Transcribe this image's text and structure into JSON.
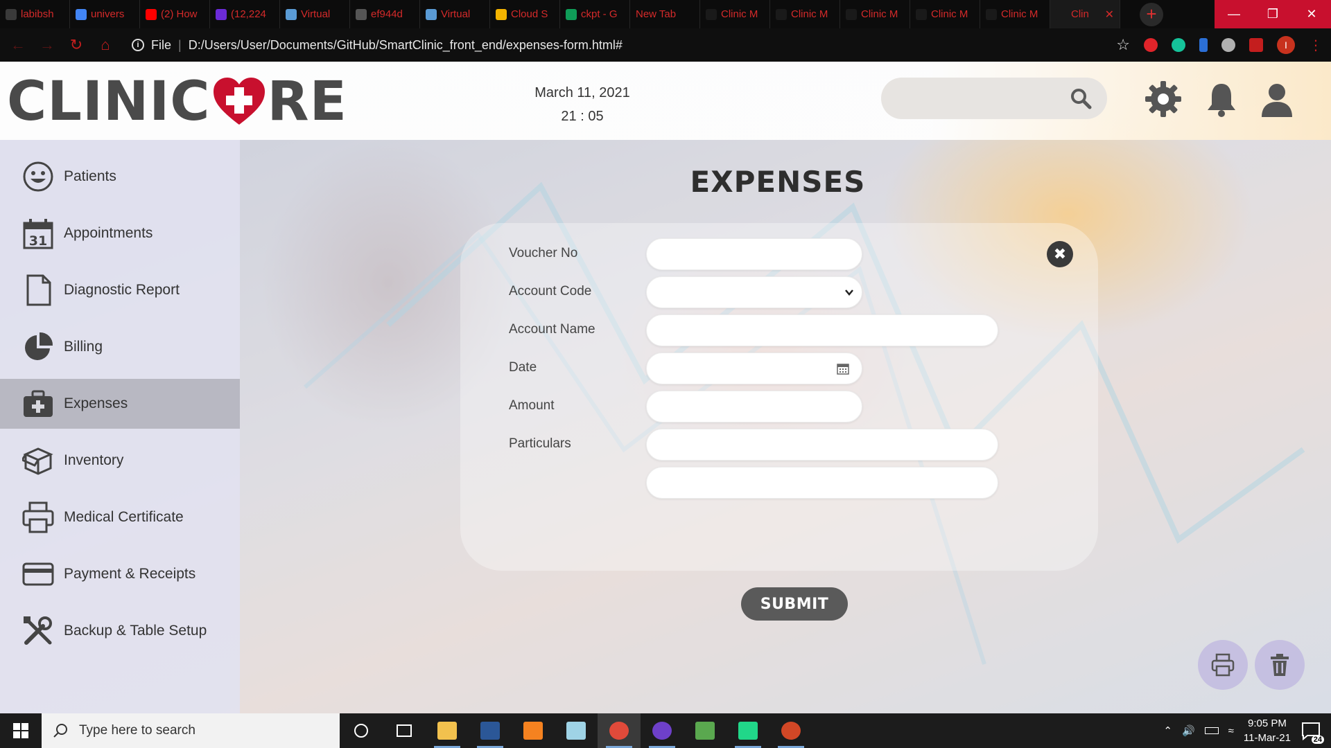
{
  "browser": {
    "tabs": [
      {
        "title": "labibsh",
        "fav": "#3a3a3a"
      },
      {
        "title": "univers",
        "fav": "#4285f4"
      },
      {
        "title": "(2) How",
        "fav": "#ff0000"
      },
      {
        "title": "(12,224",
        "fav": "#6b2bd8"
      },
      {
        "title": "Virtual",
        "fav": "#5a9bd5"
      },
      {
        "title": "ef944d",
        "fav": "#555555"
      },
      {
        "title": "Virtual",
        "fav": "#5a9bd5"
      },
      {
        "title": "Cloud S",
        "fav": "#f4b400"
      },
      {
        "title": "ckpt - G",
        "fav": "#0f9d58"
      },
      {
        "title": "New Tab",
        "fav": ""
      },
      {
        "title": "Clinic M",
        "fav": "#1a1a1a"
      },
      {
        "title": "Clinic M",
        "fav": "#1a1a1a"
      },
      {
        "title": "Clinic M",
        "fav": "#1a1a1a"
      },
      {
        "title": "Clinic M",
        "fav": "#1a1a1a"
      },
      {
        "title": "Clinic M",
        "fav": "#1a1a1a"
      },
      {
        "title": "Clin",
        "fav": "#1a1a1a",
        "active": true
      }
    ],
    "new_tab_label": "+",
    "address": {
      "scheme": "File",
      "url": "D:/Users/User/Documents/GitHub/SmartClinic_front_end/expenses-form.html#"
    },
    "profile_initial": "I",
    "accent": "#c8102e"
  },
  "header": {
    "logo_left": "CLINIC",
    "logo_right": "RE",
    "date": "March 11, 2021",
    "time": "21 : 05",
    "search_placeholder": ""
  },
  "sidebar": {
    "items": [
      {
        "label": "Patients",
        "icon": "smiley-face-icon"
      },
      {
        "label": "Appointments",
        "icon": "calendar-icon"
      },
      {
        "label": "Diagnostic Report",
        "icon": "document-icon"
      },
      {
        "label": "Billing",
        "icon": "pie-chart-icon"
      },
      {
        "label": "Expenses",
        "icon": "medical-bag-icon",
        "active": true
      },
      {
        "label": "Inventory",
        "icon": "open-box-icon"
      },
      {
        "label": "Medical Certificate",
        "icon": "printer-icon"
      },
      {
        "label": "Payment & Receipts",
        "icon": "credit-card-icon"
      },
      {
        "label": "Backup & Table Setup",
        "icon": "tools-icon"
      }
    ]
  },
  "page": {
    "title": "EXPENSES",
    "close_label": "✖",
    "submit_label": "SUBMIT"
  },
  "form": {
    "fields": [
      {
        "label": "Voucher No",
        "value": "",
        "type": "text"
      },
      {
        "label": "Account Code",
        "value": "",
        "type": "select"
      },
      {
        "label": "Account Name",
        "value": "",
        "type": "text"
      },
      {
        "label": "Date",
        "value": "",
        "type": "date"
      },
      {
        "label": "Amount",
        "value": "",
        "type": "text"
      },
      {
        "label": "Particulars",
        "value": "",
        "type": "text"
      },
      {
        "label": "",
        "value": "",
        "type": "text"
      }
    ]
  },
  "taskbar": {
    "search_placeholder": "Type here to search",
    "time": "9:05 PM",
    "date": "11-Mar-21",
    "notification_count": "24"
  }
}
